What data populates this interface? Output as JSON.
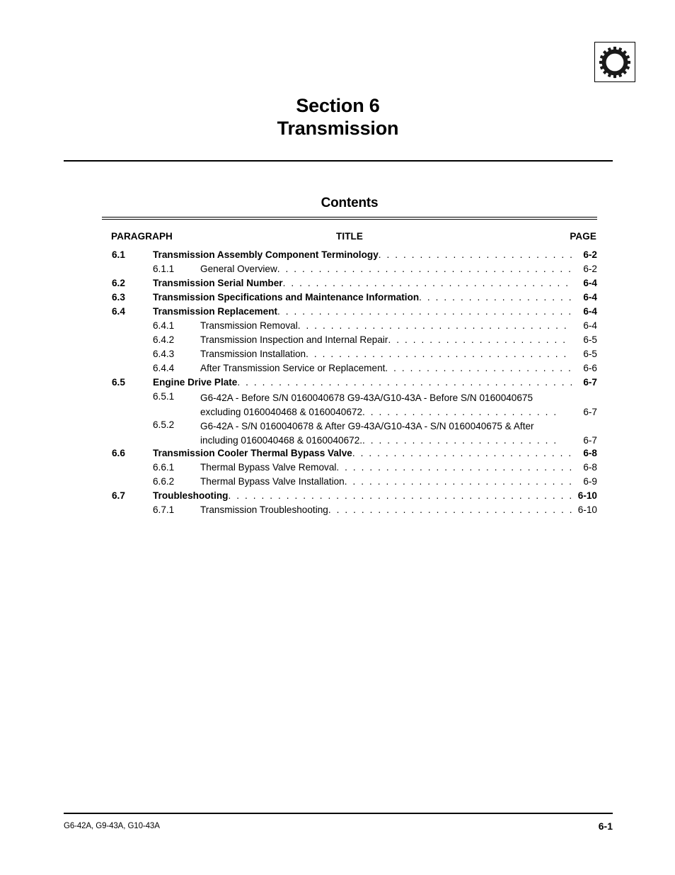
{
  "header": {
    "badge_icon": "gear-icon",
    "section_label": "Section 6",
    "section_name": "Transmission"
  },
  "contents": {
    "heading": "Contents",
    "columns": {
      "paragraph": "PARAGRAPH",
      "title": "TITLE",
      "page": "PAGE"
    },
    "entries": [
      {
        "level": 1,
        "number": "6.1",
        "title": "Transmission Assembly Component Terminology",
        "page": "6-2"
      },
      {
        "level": 2,
        "number": "6.1.1",
        "title": "General Overview",
        "page": "6-2"
      },
      {
        "level": 1,
        "number": "6.2",
        "title": "Transmission Serial Number",
        "page": "6-4"
      },
      {
        "level": 1,
        "number": "6.3",
        "title": "Transmission Specifications and Maintenance Information",
        "page": "6-4"
      },
      {
        "level": 1,
        "number": "6.4",
        "title": "Transmission Replacement",
        "page": "6-4"
      },
      {
        "level": 2,
        "number": "6.4.1",
        "title": "Transmission Removal",
        "page": "6-4"
      },
      {
        "level": 2,
        "number": "6.4.2",
        "title": "Transmission Inspection and Internal Repair",
        "page": "6-5"
      },
      {
        "level": 2,
        "number": "6.4.3",
        "title": "Transmission Installation",
        "page": "6-5"
      },
      {
        "level": 2,
        "number": "6.4.4",
        "title": "After Transmission Service or Replacement",
        "page": "6-6"
      },
      {
        "level": 1,
        "number": "6.5",
        "title": "Engine Drive Plate",
        "page": "6-7"
      },
      {
        "level": 2,
        "number": "6.5.1",
        "title_line1": "G6-42A - Before S/N 0160040678 G9-43A/G10-43A - Before S/N 0160040675",
        "title_line2": "excluding 0160040468 & 0160040672",
        "page": "6-7"
      },
      {
        "level": 2,
        "number": "6.5.2",
        "title_line1": "G6-42A - S/N 0160040678 & After G9-43A/G10-43A - S/N 0160040675 & After",
        "title_line2": "including 0160040468 & 0160040672.",
        "page": "6-7"
      },
      {
        "level": 1,
        "number": "6.6",
        "title": "Transmission Cooler Thermal Bypass Valve",
        "page": "6-8"
      },
      {
        "level": 2,
        "number": "6.6.1",
        "title": "Thermal Bypass Valve Removal",
        "page": "6-8"
      },
      {
        "level": 2,
        "number": "6.6.2",
        "title": "Thermal Bypass Valve Installation",
        "page": "6-9"
      },
      {
        "level": 1,
        "number": "6.7",
        "title": "Troubleshooting",
        "page": "6-10"
      },
      {
        "level": 2,
        "number": "6.7.1",
        "title": "Transmission Troubleshooting",
        "page": "6-10"
      }
    ]
  },
  "footer": {
    "models": "G6-42A, G9-43A, G10-43A",
    "page_number": "6-1"
  }
}
